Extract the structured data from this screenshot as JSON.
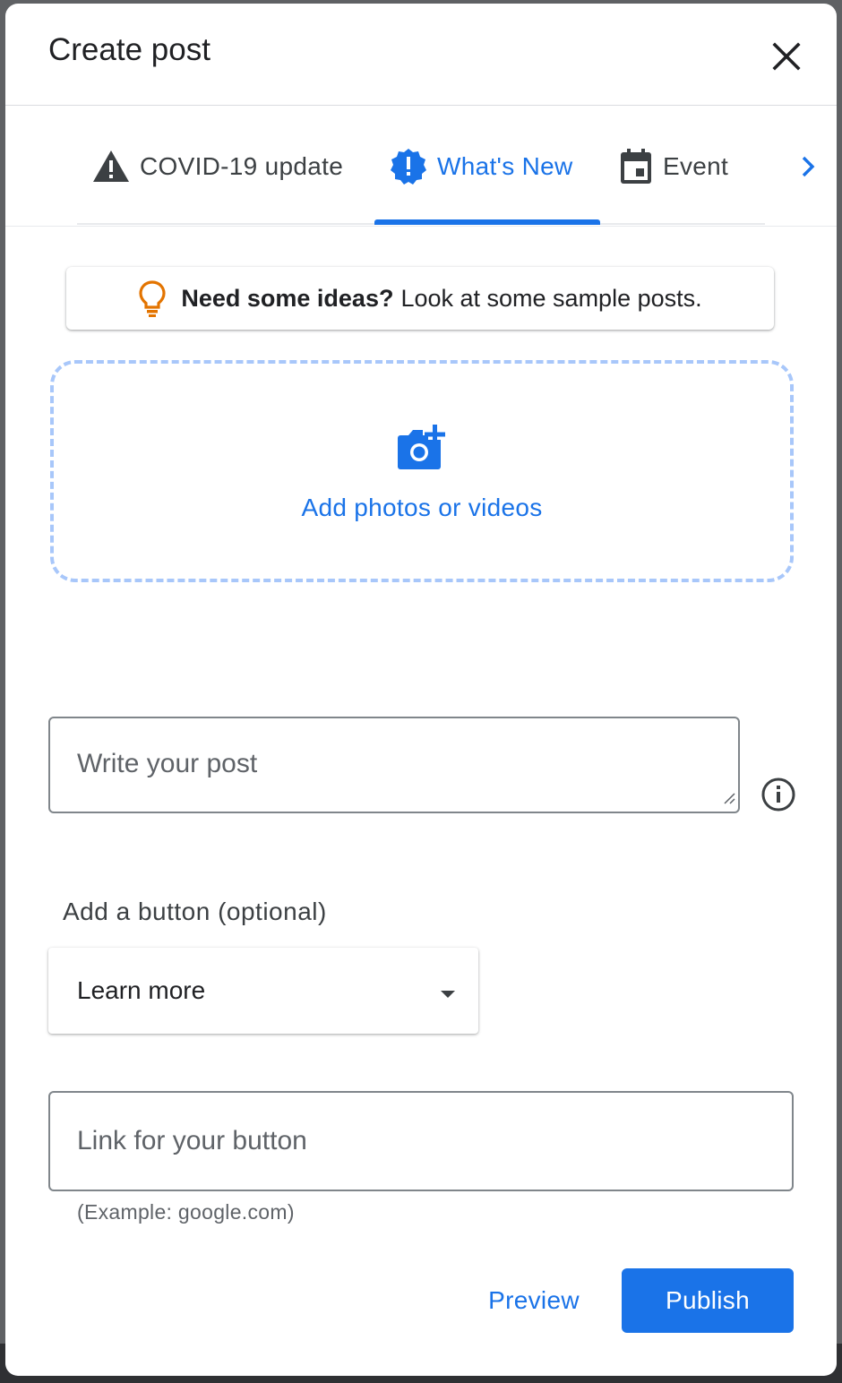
{
  "dialog": {
    "title": "Create post",
    "close_icon": "close-icon"
  },
  "tabs": {
    "items": [
      {
        "label": "COVID-19 update",
        "icon": "warning-icon",
        "active": false
      },
      {
        "label": "What's New",
        "icon": "new-releases-icon",
        "active": true
      },
      {
        "label": "Event",
        "icon": "calendar-icon",
        "active": false
      }
    ],
    "next_icon": "chevron-right-icon"
  },
  "ideas": {
    "icon": "lightbulb-icon",
    "bold": "Need some ideas?",
    "text": "Look at some sample posts."
  },
  "media": {
    "icon": "add-photo-icon",
    "label": "Add photos or videos"
  },
  "post": {
    "placeholder": "Write your post",
    "value": "",
    "info_icon": "info-icon"
  },
  "button_section": {
    "label": "Add a button (optional)",
    "selected": "Learn more",
    "caret_icon": "caret-down-icon"
  },
  "link": {
    "placeholder": "Link for your button",
    "value": "",
    "helper": "(Example: google.com)"
  },
  "actions": {
    "preview": "Preview",
    "publish": "Publish"
  },
  "colors": {
    "accent": "#1a73e8",
    "dashed_border": "#a8c7fa",
    "bulb": "#e37400",
    "text": "#202124",
    "secondary_text": "#5f6368"
  }
}
